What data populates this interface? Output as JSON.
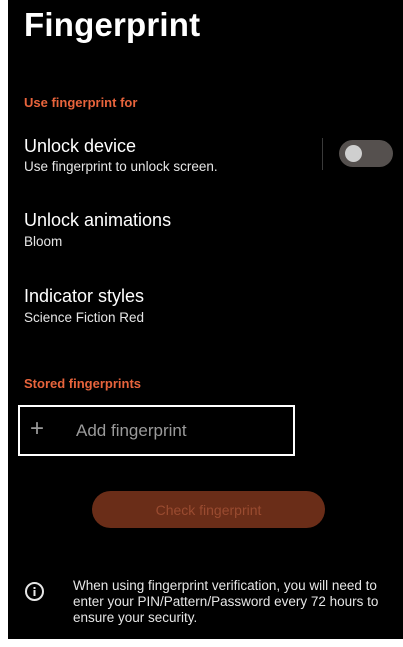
{
  "page": {
    "title": "Fingerprint"
  },
  "sections": {
    "use_for": "Use fingerprint for",
    "stored": "Stored fingerprints"
  },
  "unlock_device": {
    "title": "Unlock device",
    "subtitle": "Use fingerprint to unlock screen.",
    "toggle_state": "off"
  },
  "unlock_animations": {
    "title": "Unlock animations",
    "subtitle": "Bloom"
  },
  "indicator_styles": {
    "title": "Indicator styles",
    "subtitle": "Science Fiction Red"
  },
  "add_fingerprint": {
    "icon": "plus-icon",
    "label": "Add fingerprint"
  },
  "check_fingerprint": {
    "label": "Check fingerprint"
  },
  "info": {
    "icon": "info-icon",
    "text": "When using fingerprint verification, you will need to enter your PIN/Pattern/Password every 72 hours to ensure your security."
  },
  "colors": {
    "accent": "#e8643c",
    "background": "#000000",
    "button_disabled": "#6a2d18"
  }
}
